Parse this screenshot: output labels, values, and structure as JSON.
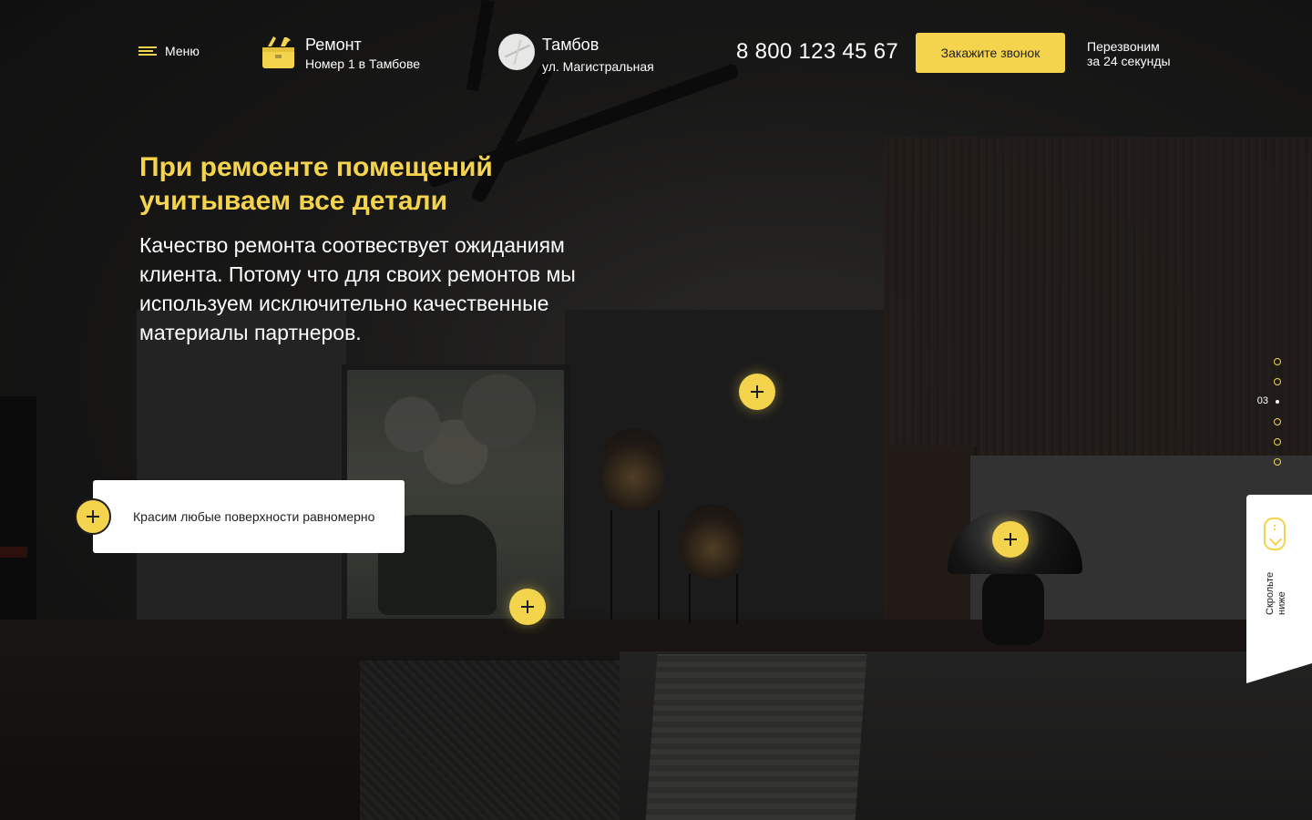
{
  "header": {
    "menu_label": "Меню",
    "brand": {
      "title": "Ремонт",
      "subtitle": "Номер 1 в Тамбове",
      "icon": "toolbox-icon"
    },
    "city": {
      "title": "Тамбов",
      "subtitle": "ул. Магистральная",
      "icon": "map-thumbnail"
    },
    "phone": "8 800 123 45 67",
    "call_button": "Закажите звонок",
    "callback_note": [
      "Перезвоним",
      "за 24 секунды"
    ]
  },
  "hero": {
    "title_lines": [
      "При ремоенте помещений",
      "учитываем все детали"
    ],
    "description": "Качество ремонта соотвествует ожиданиям клиента. Потому что для своих ремонтов мы используем исключительно качественные материалы партнеров."
  },
  "tooltip": {
    "text": "Красим любые поверхности равномерно"
  },
  "pager": {
    "current": "03",
    "total_dots": 6,
    "active_index": 2
  },
  "scroll_hint": {
    "label_lines": [
      "Скрольте",
      "ниже"
    ]
  },
  "colors": {
    "accent": "#f5d44d",
    "dark": "#1f1f1f"
  }
}
